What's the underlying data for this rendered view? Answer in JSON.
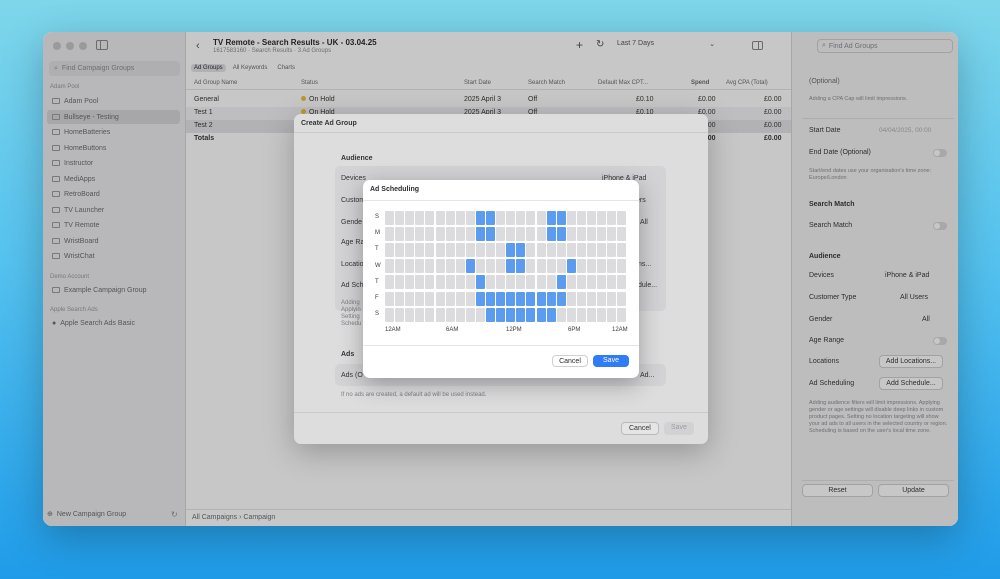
{
  "sidebar": {
    "search_placeholder": "Find Campaign Groups",
    "sections": [
      {
        "title": "Adam Pool",
        "items": [
          "Adam Pool",
          "Bullseye - Testing",
          "HomeBatteries",
          "HomeButtons",
          "Instructor",
          "MediApps",
          "RetroBoard",
          "TV Launcher",
          "TV Remote",
          "WristBoard",
          "WristChat"
        ]
      },
      {
        "title": "Demo Account",
        "items": [
          "Example Campaign Group"
        ]
      },
      {
        "title": "Apple Search Ads",
        "items": [
          "Apple Search Ads Basic"
        ]
      }
    ],
    "active_item": "Bullseye - Testing",
    "new_group": "New Campaign Group"
  },
  "header": {
    "title": "TV Remote - Search Results - UK - 03.04.25",
    "subtitle": "1617583160 · Search Results · 3 Ad Groups",
    "date_range": "Last 7 Days",
    "search_placeholder": "Find Ad Groups"
  },
  "tabs": [
    "Ad Groups",
    "All Keywords",
    "Charts"
  ],
  "table": {
    "columns": [
      "Ad Group Name",
      "Status",
      "Start Date",
      "Search Match",
      "Default Max CPT...",
      "Spend",
      "Avg CPA (Total)"
    ],
    "rows": [
      {
        "name": "General",
        "status": "On Hold",
        "start": "2025 April 3",
        "match": "Off",
        "cpt": "£0.10",
        "spend": "£0.00",
        "cpa": "£0.00"
      },
      {
        "name": "Test 1",
        "status": "On Hold",
        "start": "2025 April 3",
        "match": "Off",
        "cpt": "£0.10",
        "spend": "£0.00",
        "cpa": "£0.00"
      },
      {
        "name": "Test 2",
        "status": "",
        "start": "",
        "match": "",
        "cpt": "",
        "spend": "£0.00",
        "cpa": "£0.00"
      }
    ],
    "totals": {
      "label": "Totals",
      "spend": "£0.00",
      "cpa": "£0.00"
    }
  },
  "breadcrumb": {
    "all": "All Campaigns",
    "sep": "›",
    "current": "Campaign"
  },
  "right_panel": {
    "cpa_label": "(Optional)",
    "cpa_note": "Adding a CPA Cap will limit impressions.",
    "start_date_label": "Start Date",
    "start_date_value": "04/04/2025, 00:00",
    "end_date_label": "End Date (Optional)",
    "date_note": "Start/end dates use your organisation's time zone: Europe/London",
    "search_match_head": "Search Match",
    "search_match_label": "Search Match",
    "audience_head": "Audience",
    "devices_label": "Devices",
    "devices_value": "iPhone & iPad",
    "customer_type_label": "Customer Type",
    "customer_type_value": "All Users",
    "gender_label": "Gender",
    "gender_value": "All",
    "age_label": "Age Range",
    "locations_label": "Locations",
    "locations_button": "Add Locations...",
    "scheduling_label": "Ad Scheduling",
    "scheduling_button": "Add Schedule...",
    "audience_note": "Adding audience filters will limit impressions. Applying gender or age settings will disable deep links in custom product pages. Setting no location targeting will show your ad ads to all users in the selected country or region. Scheduling is based on the user's local time zone.",
    "reset": "Reset",
    "update": "Update"
  },
  "create_sheet": {
    "title": "Create Ad Group",
    "audience_head": "Audience",
    "devices": "Devices",
    "devices_value": "iPhone & iPad",
    "customer": "Custom",
    "customer_value": "ers",
    "gender": "Gende",
    "gender_value": "All",
    "age": "Age Ra",
    "location": "Locatio",
    "location_value": "ns...",
    "schedule": "Ad Sch",
    "schedule_value": "dule...",
    "note1": "Adding",
    "note2": "Applyin",
    "note3": "Setting",
    "note4": "Schedu",
    "ads_head": "Ads",
    "ads": "Ads (O",
    "ads_value": "Ad...",
    "ads_note": "If no ads are created, a default ad will be used instead.",
    "cancel": "Cancel",
    "save": "Save"
  },
  "scheduler": {
    "title": "Ad Scheduling",
    "days": [
      "S",
      "M",
      "T",
      "W",
      "T",
      "F",
      "S"
    ],
    "hour_labels": [
      "12AM",
      "6AM",
      "12PM",
      "6PM",
      "12AM"
    ],
    "selected": [
      [
        9,
        10,
        16,
        17
      ],
      [
        9,
        10,
        16,
        17
      ],
      [
        12,
        13
      ],
      [
        8,
        12,
        13,
        18
      ],
      [
        9,
        17
      ],
      [
        9,
        10,
        11,
        12,
        13,
        14,
        15,
        16,
        17
      ],
      [
        10,
        11,
        12,
        13,
        14,
        15,
        16
      ]
    ],
    "cancel": "Cancel",
    "save": "Save",
    "colors": {
      "on": "#5b9cf0",
      "off": "#dcdcdf"
    }
  }
}
